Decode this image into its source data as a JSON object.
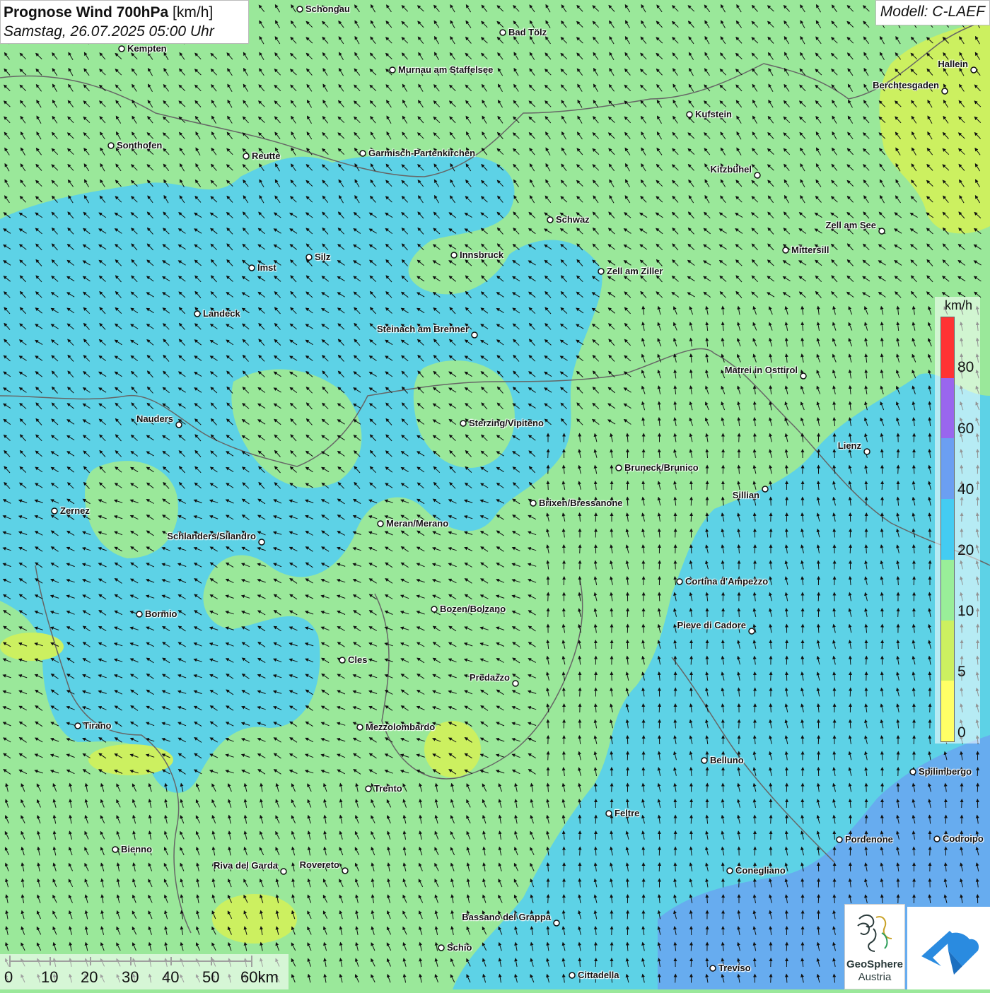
{
  "header": {
    "title_bold": "Prognose Wind 700hPa",
    "title_unit": "[km/h]",
    "datetime": "Samstag, 26.07.2025 05:00 Uhr",
    "model": "Modell: C-LAEF"
  },
  "legend": {
    "unit": "km/h",
    "segments": [
      {
        "color": "#ff3333"
      },
      {
        "color": "#9966ee"
      },
      {
        "color": "#6b9ff2"
      },
      {
        "color": "#44ccf2"
      },
      {
        "color": "#99ee99"
      },
      {
        "color": "#ccf060"
      },
      {
        "color": "#ffff66"
      }
    ],
    "ticks": [
      "80",
      "60",
      "40",
      "20",
      "10",
      "5",
      "0"
    ]
  },
  "scale": {
    "labels": [
      "0",
      "10",
      "20",
      "30",
      "40",
      "50",
      "60km"
    ]
  },
  "logo": {
    "name_line1": "GeoSphere",
    "name_line2": "Austria"
  },
  "cities": [
    {
      "name": "Schongau"
    },
    {
      "name": "Bad Tölz"
    },
    {
      "name": "Kempten"
    },
    {
      "name": "Murnau am Staffelsee"
    },
    {
      "name": "Hallein"
    },
    {
      "name": "Berchtesgaden"
    },
    {
      "name": "Kufstein"
    },
    {
      "name": "Sonthofen"
    },
    {
      "name": "Reutte"
    },
    {
      "name": "Garmisch-Partenkirchen"
    },
    {
      "name": "Kitzbühel"
    },
    {
      "name": "Schwaz"
    },
    {
      "name": "Zell am See"
    },
    {
      "name": "Mittersill"
    },
    {
      "name": "Innsbruck"
    },
    {
      "name": "Silz"
    },
    {
      "name": "Imst"
    },
    {
      "name": "Zell am Ziller"
    },
    {
      "name": "Landeck"
    },
    {
      "name": "Steinach am Brenner"
    },
    {
      "name": "Matrei in Osttirol"
    },
    {
      "name": "Nauders"
    },
    {
      "name": "Sterzing/Vipiteno"
    },
    {
      "name": "Lienz"
    },
    {
      "name": "Bruneck/Brunico"
    },
    {
      "name": "Sillian"
    },
    {
      "name": "Zernez"
    },
    {
      "name": "Brixen/Bressanone"
    },
    {
      "name": "Meran/Merano"
    },
    {
      "name": "Schlanders/Silandro"
    },
    {
      "name": "Cortina d'Ampezzo"
    },
    {
      "name": "Bozen/Bolzano"
    },
    {
      "name": "Bormio"
    },
    {
      "name": "Pieve di Cadore"
    },
    {
      "name": "Cles"
    },
    {
      "name": "Predazzo"
    },
    {
      "name": "Tirano"
    },
    {
      "name": "Mezzolombardo"
    },
    {
      "name": "Belluno"
    },
    {
      "name": "Spilimbergo"
    },
    {
      "name": "Trento"
    },
    {
      "name": "Feltre"
    },
    {
      "name": "Pordenone"
    },
    {
      "name": "Codroipo"
    },
    {
      "name": "Bienno"
    },
    {
      "name": "Riva del Garda"
    },
    {
      "name": "Rovereto"
    },
    {
      "name": "Conegliano"
    },
    {
      "name": "Bassano del Grappa"
    },
    {
      "name": "Schio"
    },
    {
      "name": "Treviso"
    },
    {
      "name": "Cittadella"
    }
  ]
}
